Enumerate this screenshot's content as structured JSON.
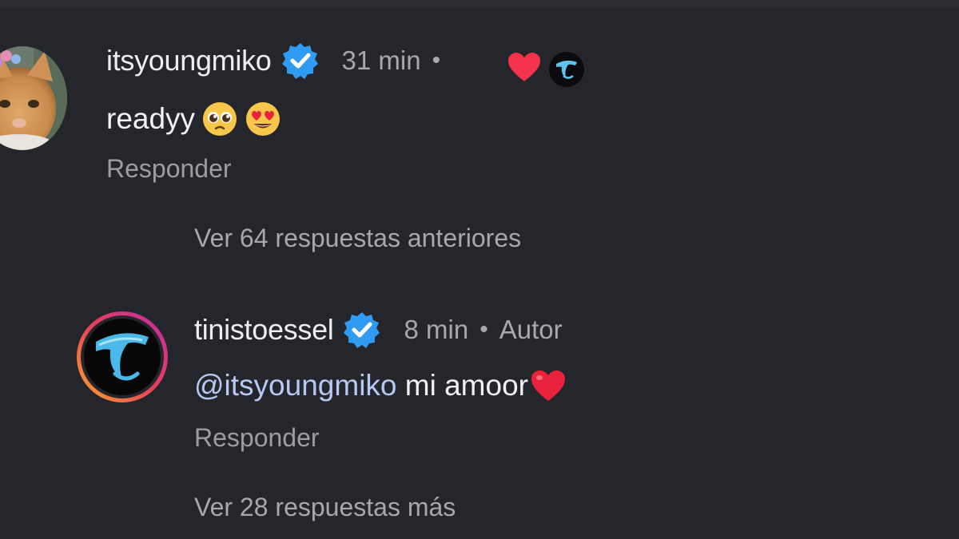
{
  "comments": [
    {
      "username": "itsyoungmiko",
      "time": "31 min",
      "separator": "•",
      "text": "readyy",
      "emojis": [
        "pleading-face",
        "heart-eyes-face"
      ],
      "reply_label": "Responder",
      "liked_by_author": true
    },
    {
      "username": "tinistoessel",
      "time": "8 min",
      "separator": "•",
      "author_label": "Autor",
      "mention": "@itsyoungmiko",
      "text": " mi amoor",
      "emoji": "red-heart",
      "reply_label": "Responder"
    }
  ],
  "view_previous_replies": "Ver 64 respuestas anteriores",
  "view_more_replies": "Ver 28 respuestas más",
  "icons": {
    "verified": "verified-badge-icon",
    "like": "heart-icon",
    "author_badge": "tini-logo-icon"
  },
  "colors": {
    "background": "#25262c",
    "verified": "#2f9bf2",
    "like": "#f2334a",
    "mention": "#b6c9f2",
    "story_ring_start": "#f7a82b",
    "story_ring_end": "#c02ca8"
  }
}
